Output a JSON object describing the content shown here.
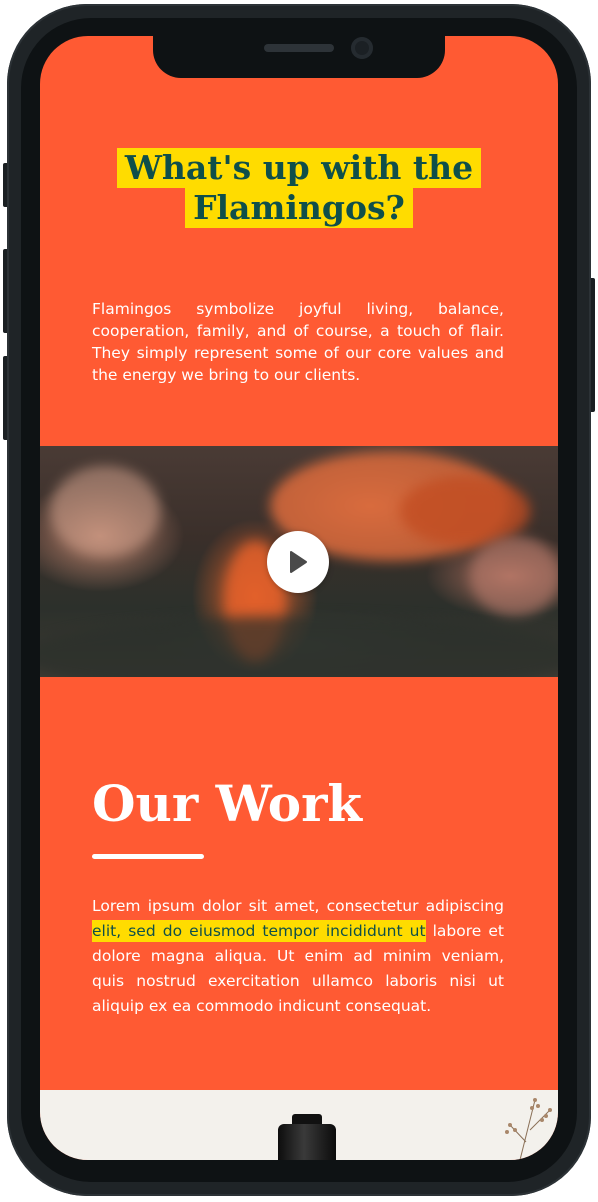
{
  "hero": {
    "title_line1": "What's up with the",
    "title_line2": "Flamingos?",
    "description": "Flamingos symbolize joyful living, balance, cooperation, family, and of course, a touch of flair. They simply represent some of our core values and the energy we bring to our clients."
  },
  "video": {
    "play_icon": "play-icon"
  },
  "work": {
    "title": "Our Work",
    "text_before": "Lorem ipsum dolor sit amet, consectetur adipiscing ",
    "text_highlight": "elit, sed do eiusmod tempor incididunt ut",
    "text_after": " labore et dolore magna aliqua. Ut enim ad minim veniam, quis nostrud exercitation ullamco laboris nisi ut aliquip ex ea commodo indicunt consequat."
  },
  "colors": {
    "background": "#ff5a33",
    "highlight": "#ffdc00",
    "title_teal": "#0f4f4a",
    "phone_frame": "#1f2427"
  }
}
